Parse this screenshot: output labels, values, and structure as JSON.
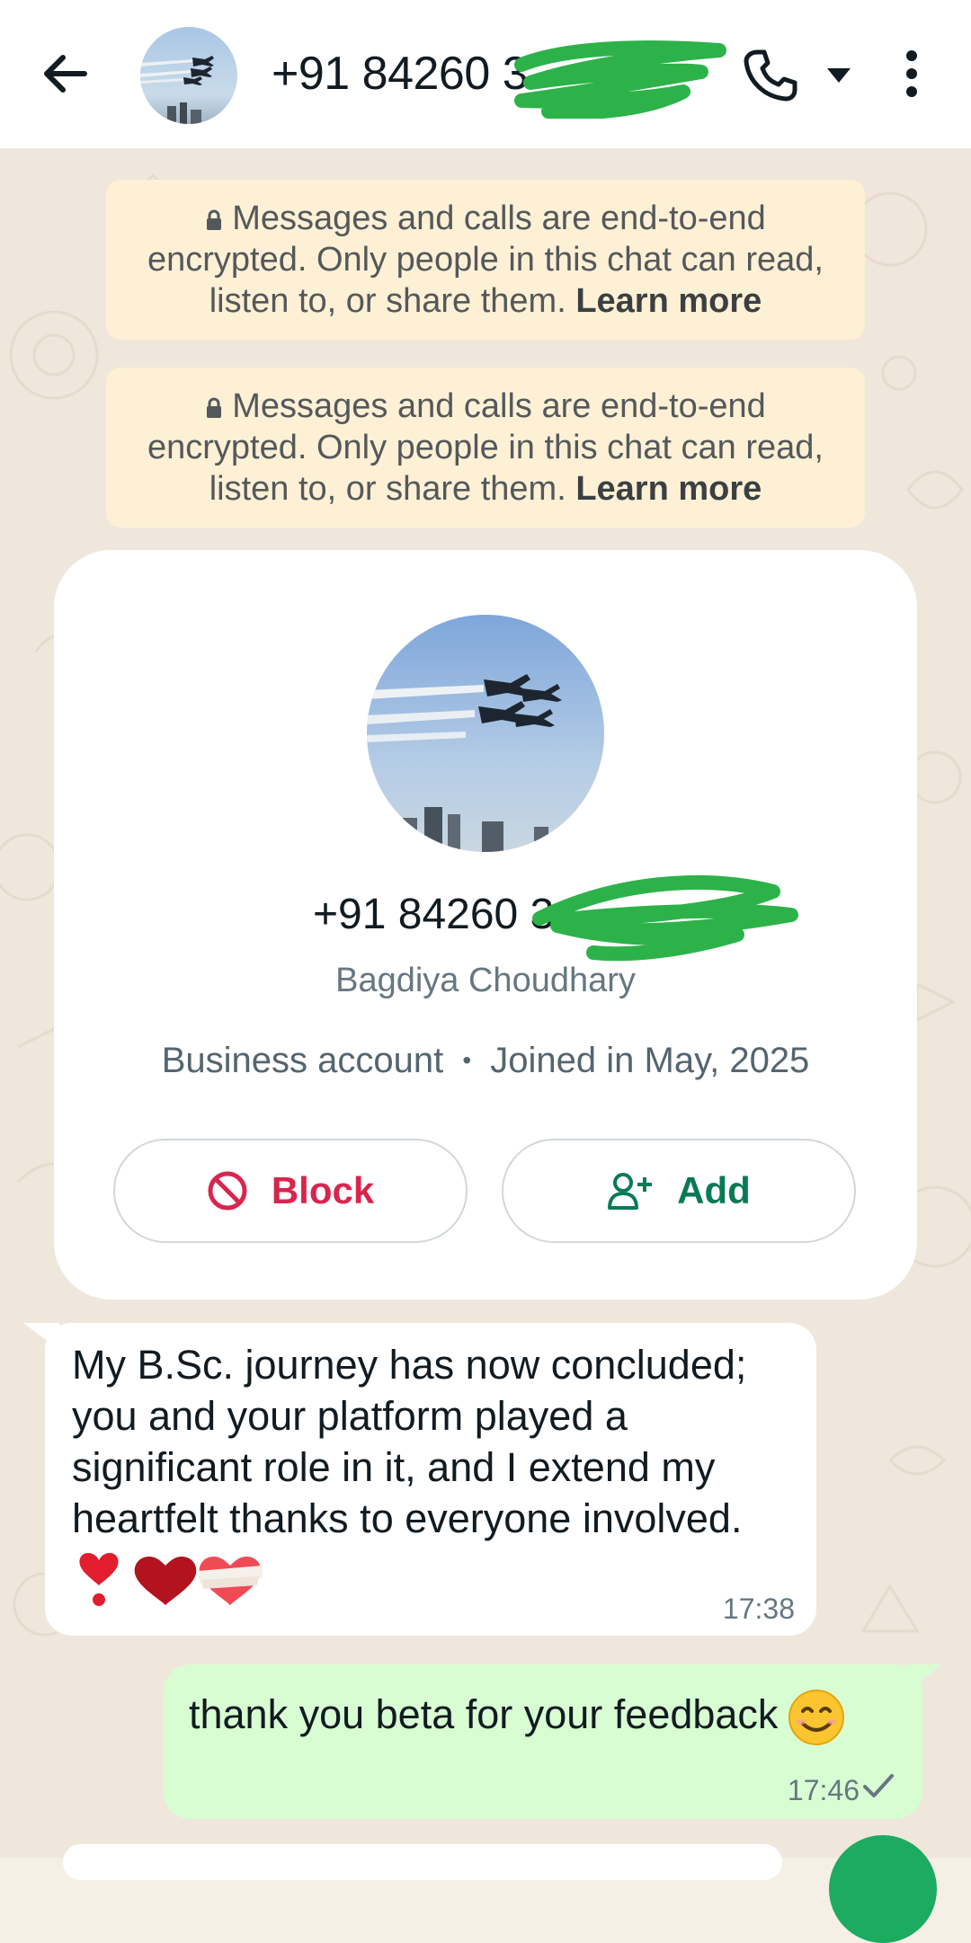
{
  "header": {
    "title": "+91 84260 3",
    "icons": [
      "back-arrow-icon",
      "avatar",
      "phone-icon",
      "caret-down-icon",
      "more-vert-icon"
    ]
  },
  "notices": [
    {
      "text": "Messages and calls are end-to-end encrypted. Only people in this chat can read, listen to, or share them. ",
      "link": "Learn more"
    },
    {
      "text": "Messages and calls are end-to-end encrypted. Only people in this chat can read, listen to, or share them. ",
      "link": "Learn more"
    }
  ],
  "profile_card": {
    "phone": "+91 84260 3",
    "name": "Bagdiya Choudhary",
    "account_type": "Business account",
    "separator": "•",
    "joined": "Joined in May, 2025",
    "block_label": "Block",
    "add_label": "Add"
  },
  "messages": [
    {
      "direction": "incoming",
      "text": "My B.Sc. journey has now concluded; you and your platform played a significant role in it, and I extend my heartfelt thanks to everyone involved.",
      "emojis": [
        "heart-exclamation",
        "red-heart",
        "mending-heart"
      ],
      "time": "17:38"
    },
    {
      "direction": "outgoing",
      "text": "thank you beta for your feedback",
      "emoji": "smiling-face",
      "time": "17:46",
      "status": "sent"
    }
  ],
  "colors": {
    "outgoing_bubble": "#d9fdd3",
    "incoming_bubble": "#ffffff",
    "notice_bg": "#fdf0d5",
    "block_red": "#d9254d",
    "add_green": "#0a7a55",
    "fab_green": "#1daa61",
    "redaction_scribble": "#2db24a"
  }
}
